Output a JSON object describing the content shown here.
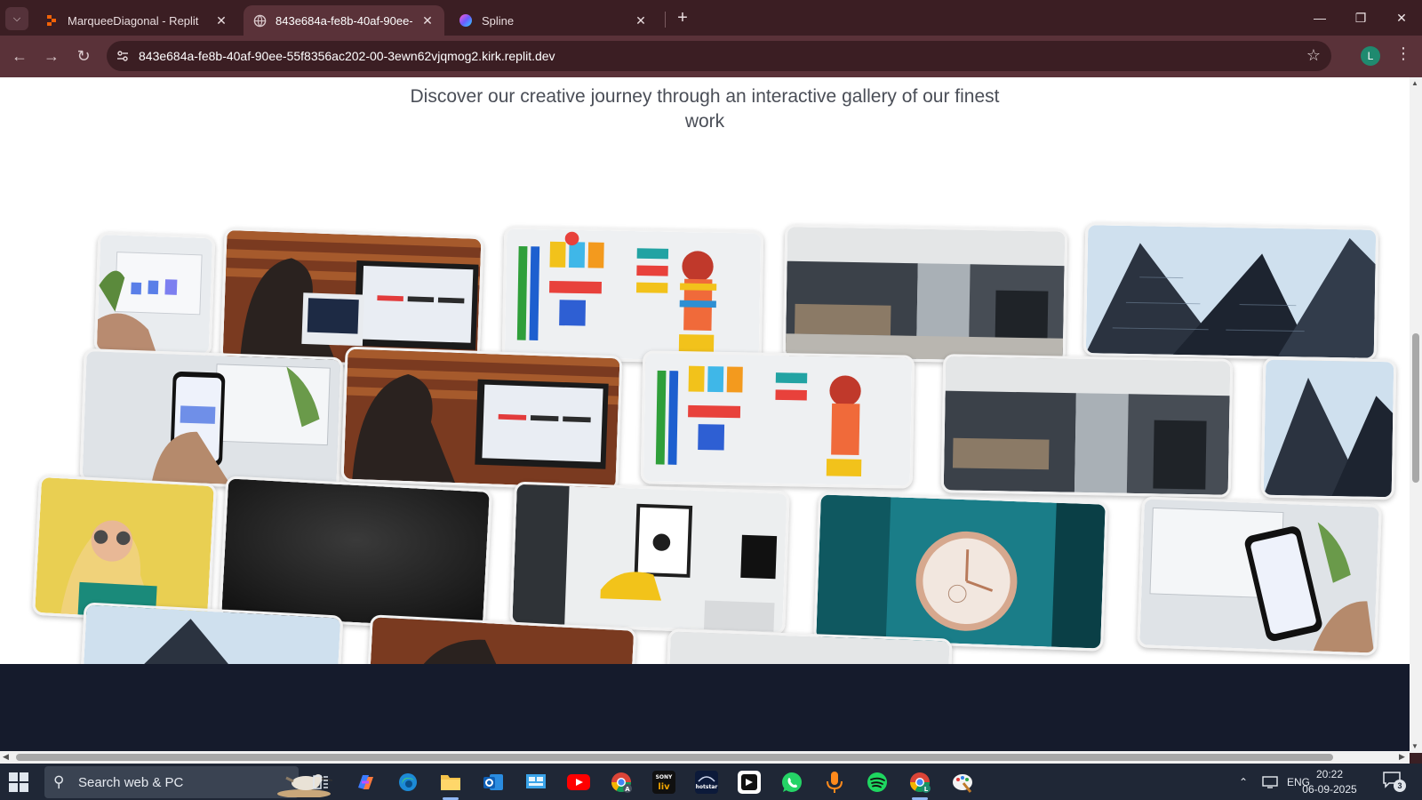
{
  "browser": {
    "tabs": [
      {
        "label": "MarqueeDiagonal - Replit",
        "icon": "replit-icon",
        "active": false
      },
      {
        "label": "843e684a-fe8b-40af-90ee-55f8",
        "icon": "globe-icon",
        "active": true
      },
      {
        "label": "Spline",
        "icon": "spline-icon",
        "active": false
      }
    ],
    "url": "843e684a-fe8b-40af-90ee-55f8356ac202-00-3ewn62vjqmog2.kirk.replit.dev",
    "profile_initial": "L"
  },
  "page": {
    "subtitle": "Discover our creative journey through an interactive gallery of our finest work",
    "gallery_images": [
      "laptop-ui-hand",
      "developer-at-monitor",
      "colorful-toys-flatlay",
      "office-corridor",
      "skyscrapers",
      "phone-app-laptop",
      "developer-at-monitor",
      "colorful-toys-flatlay",
      "office-corridor",
      "skyscrapers",
      "woman-yellow-wall",
      "dark-texture",
      "living-room-yellow-chair",
      "tissot-watch",
      "phone-app-laptop",
      "skyscrapers",
      "developer-at-monitor",
      "office-corridor"
    ]
  },
  "taskbar": {
    "search_placeholder": "Search web & PC",
    "language": "ENG",
    "time": "20:22",
    "date": "06-09-2025",
    "notification_count": "3",
    "apps": [
      "task-view",
      "copilot",
      "edge",
      "file-explorer",
      "outlook",
      "control-panel",
      "youtube",
      "chrome-profile-a",
      "sony-liv",
      "disney-hotstar",
      "capcut",
      "whatsapp",
      "voice-recorder",
      "spotify",
      "chrome-profile-l",
      "paint"
    ]
  },
  "colors": {
    "tab_strip": "#3b1e23",
    "toolbar": "#5a3239",
    "page_bg": "#ffffff",
    "page_footer": "#151b2c",
    "taskbar": "#1f2736",
    "subtitle_text": "#4a4e57"
  }
}
